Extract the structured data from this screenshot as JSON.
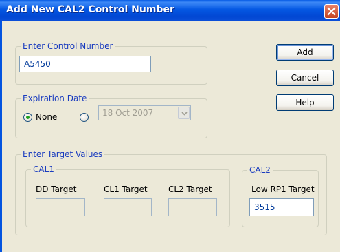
{
  "window": {
    "title": "Add New CAL2 Control Number"
  },
  "control_number": {
    "group_label": "Enter Control Number",
    "value": "A5450"
  },
  "buttons": {
    "add": "Add",
    "cancel": "Cancel",
    "help": "Help"
  },
  "expiration": {
    "group_label": "Expiration Date",
    "none_label": "None",
    "selected": "None",
    "date_value": "18 Oct 2007"
  },
  "targets": {
    "group_label": "Enter Target Values",
    "cal1": {
      "label": "CAL1",
      "dd_label": "DD Target",
      "cl1_label": "CL1 Target",
      "cl2_label": "CL2 Target",
      "dd_value": "",
      "cl1_value": "",
      "cl2_value": ""
    },
    "cal2": {
      "label": "CAL2",
      "low_rp1_label": "Low RP1 Target",
      "low_rp1_value": "3515"
    }
  },
  "colors": {
    "title_bar": "#0458E3",
    "group_label": "#1A3CBF",
    "dialog_bg": "#ECE9D8"
  }
}
